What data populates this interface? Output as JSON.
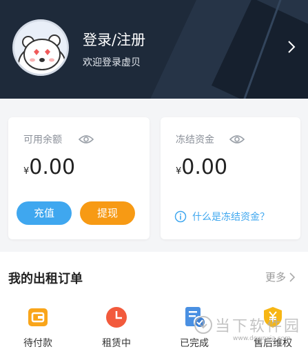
{
  "header": {
    "title": "登录/注册",
    "subtitle": "欢迎登录虚贝",
    "avatar_icon": "bear-avatar-icon",
    "background": "#1e2a3a"
  },
  "balance_card": {
    "label": "可用余额",
    "currency": "¥",
    "amount": "0.00",
    "recharge_label": "充值",
    "withdraw_label": "提现",
    "recharge_color": "#3fa7ef",
    "withdraw_color": "#f79a14"
  },
  "frozen_card": {
    "label": "冻结资金",
    "currency": "¥",
    "amount": "0.00",
    "info_link": "什么是冻结资金？",
    "link_color": "#3fa7ef"
  },
  "orders": {
    "title": "我的出租订单",
    "more_label": "更多",
    "items": [
      {
        "label": "待付款",
        "icon": "wallet-icon"
      },
      {
        "label": "租赁中",
        "icon": "clock-icon"
      },
      {
        "label": "已完成",
        "icon": "check-document-icon"
      },
      {
        "label": "售后维权",
        "icon": "shield-yen-icon"
      }
    ]
  },
  "watermark": {
    "text": "当下软件园",
    "url": "www.downxia.com"
  }
}
